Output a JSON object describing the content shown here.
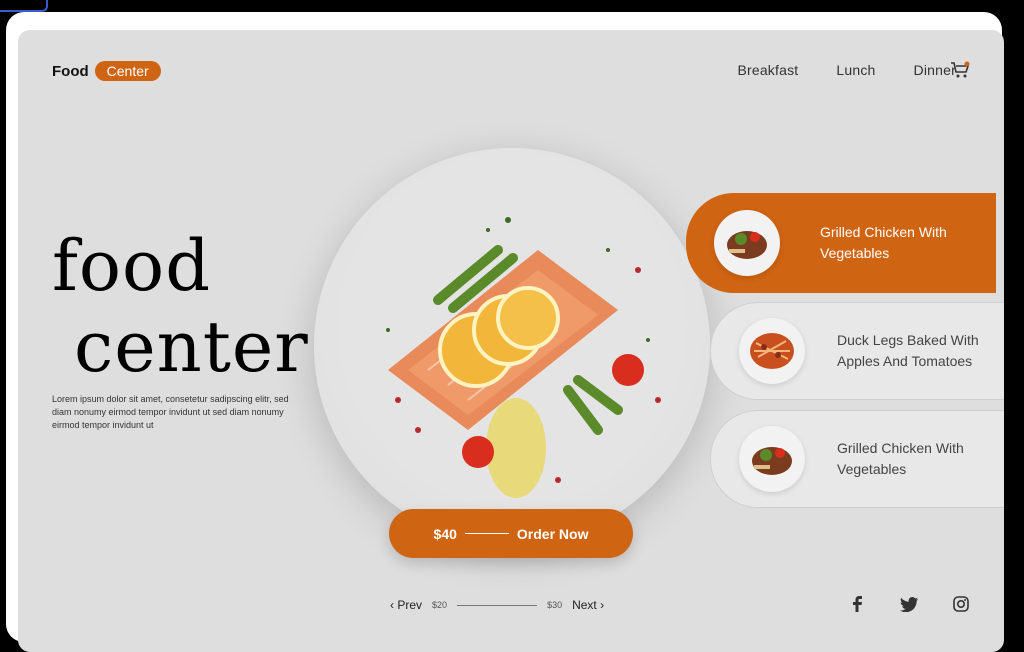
{
  "brand": {
    "first": "Food",
    "second": "Center"
  },
  "nav": {
    "items": [
      "Breakfast",
      "Lunch",
      "Dinner"
    ],
    "cart_icon": "cart-icon"
  },
  "hero": {
    "line1": "food",
    "line2": "center",
    "description": "Lorem ipsum dolor sit amet, consetetur sadipscing elitr, sed diam nonumy eirmod tempor invidunt ut sed diam nonumy eirmod tempor invidunt ut"
  },
  "order": {
    "price": "$40",
    "label": "Order Now"
  },
  "menu": [
    {
      "label": "Grilled Chicken With Vegetables",
      "active": true
    },
    {
      "label": "Duck Legs Baked With Apples And Tomatoes",
      "active": false
    },
    {
      "label": "Grilled Chicken With Vegetables",
      "active": false
    }
  ],
  "pager": {
    "prev": "Prev",
    "next": "Next",
    "min_price": "$20",
    "max_price": "$30"
  },
  "social": [
    "facebook-icon",
    "twitter-icon",
    "instagram-icon"
  ],
  "colors": {
    "accent": "#cf6412",
    "background": "#dedede"
  }
}
